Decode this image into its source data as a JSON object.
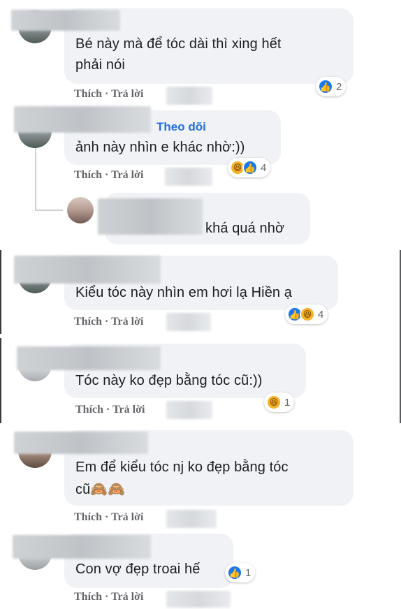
{
  "comments": [
    {
      "text": "Bé này mà để tóc dài thì xing hết",
      "text2": "phải nói",
      "like": "Thích",
      "reply": "Trả lời",
      "count": "2"
    },
    {
      "follow": "Theo dõi",
      "text": "ảnh này nhìn e khác nhờ:))",
      "like": "Thích",
      "reply": "Trả lời",
      "count": "4"
    },
    {
      "text": "khá quá nhờ"
    },
    {
      "text": "Kiểu tóc này nhìn em hơi lạ Hiền ạ",
      "like": "Thích",
      "reply": "Trả lời",
      "count": "4"
    },
    {
      "text": "Tóc này ko đẹp bằng tóc cũ:))",
      "like": "Thích",
      "reply": "Trả lời",
      "count": "1"
    },
    {
      "text": "Em để kiểu tóc nj ko đẹp bằng tóc",
      "text2": "cũ🙈🙈",
      "like": "Thích",
      "reply": "Trả lời"
    },
    {
      "text": "Con vợ đẹp troai hế",
      "like": "Thích",
      "reply": "Trả lời",
      "count": "1"
    }
  ],
  "separator": "·",
  "icons": {
    "like": "👍",
    "haha": "😆"
  }
}
